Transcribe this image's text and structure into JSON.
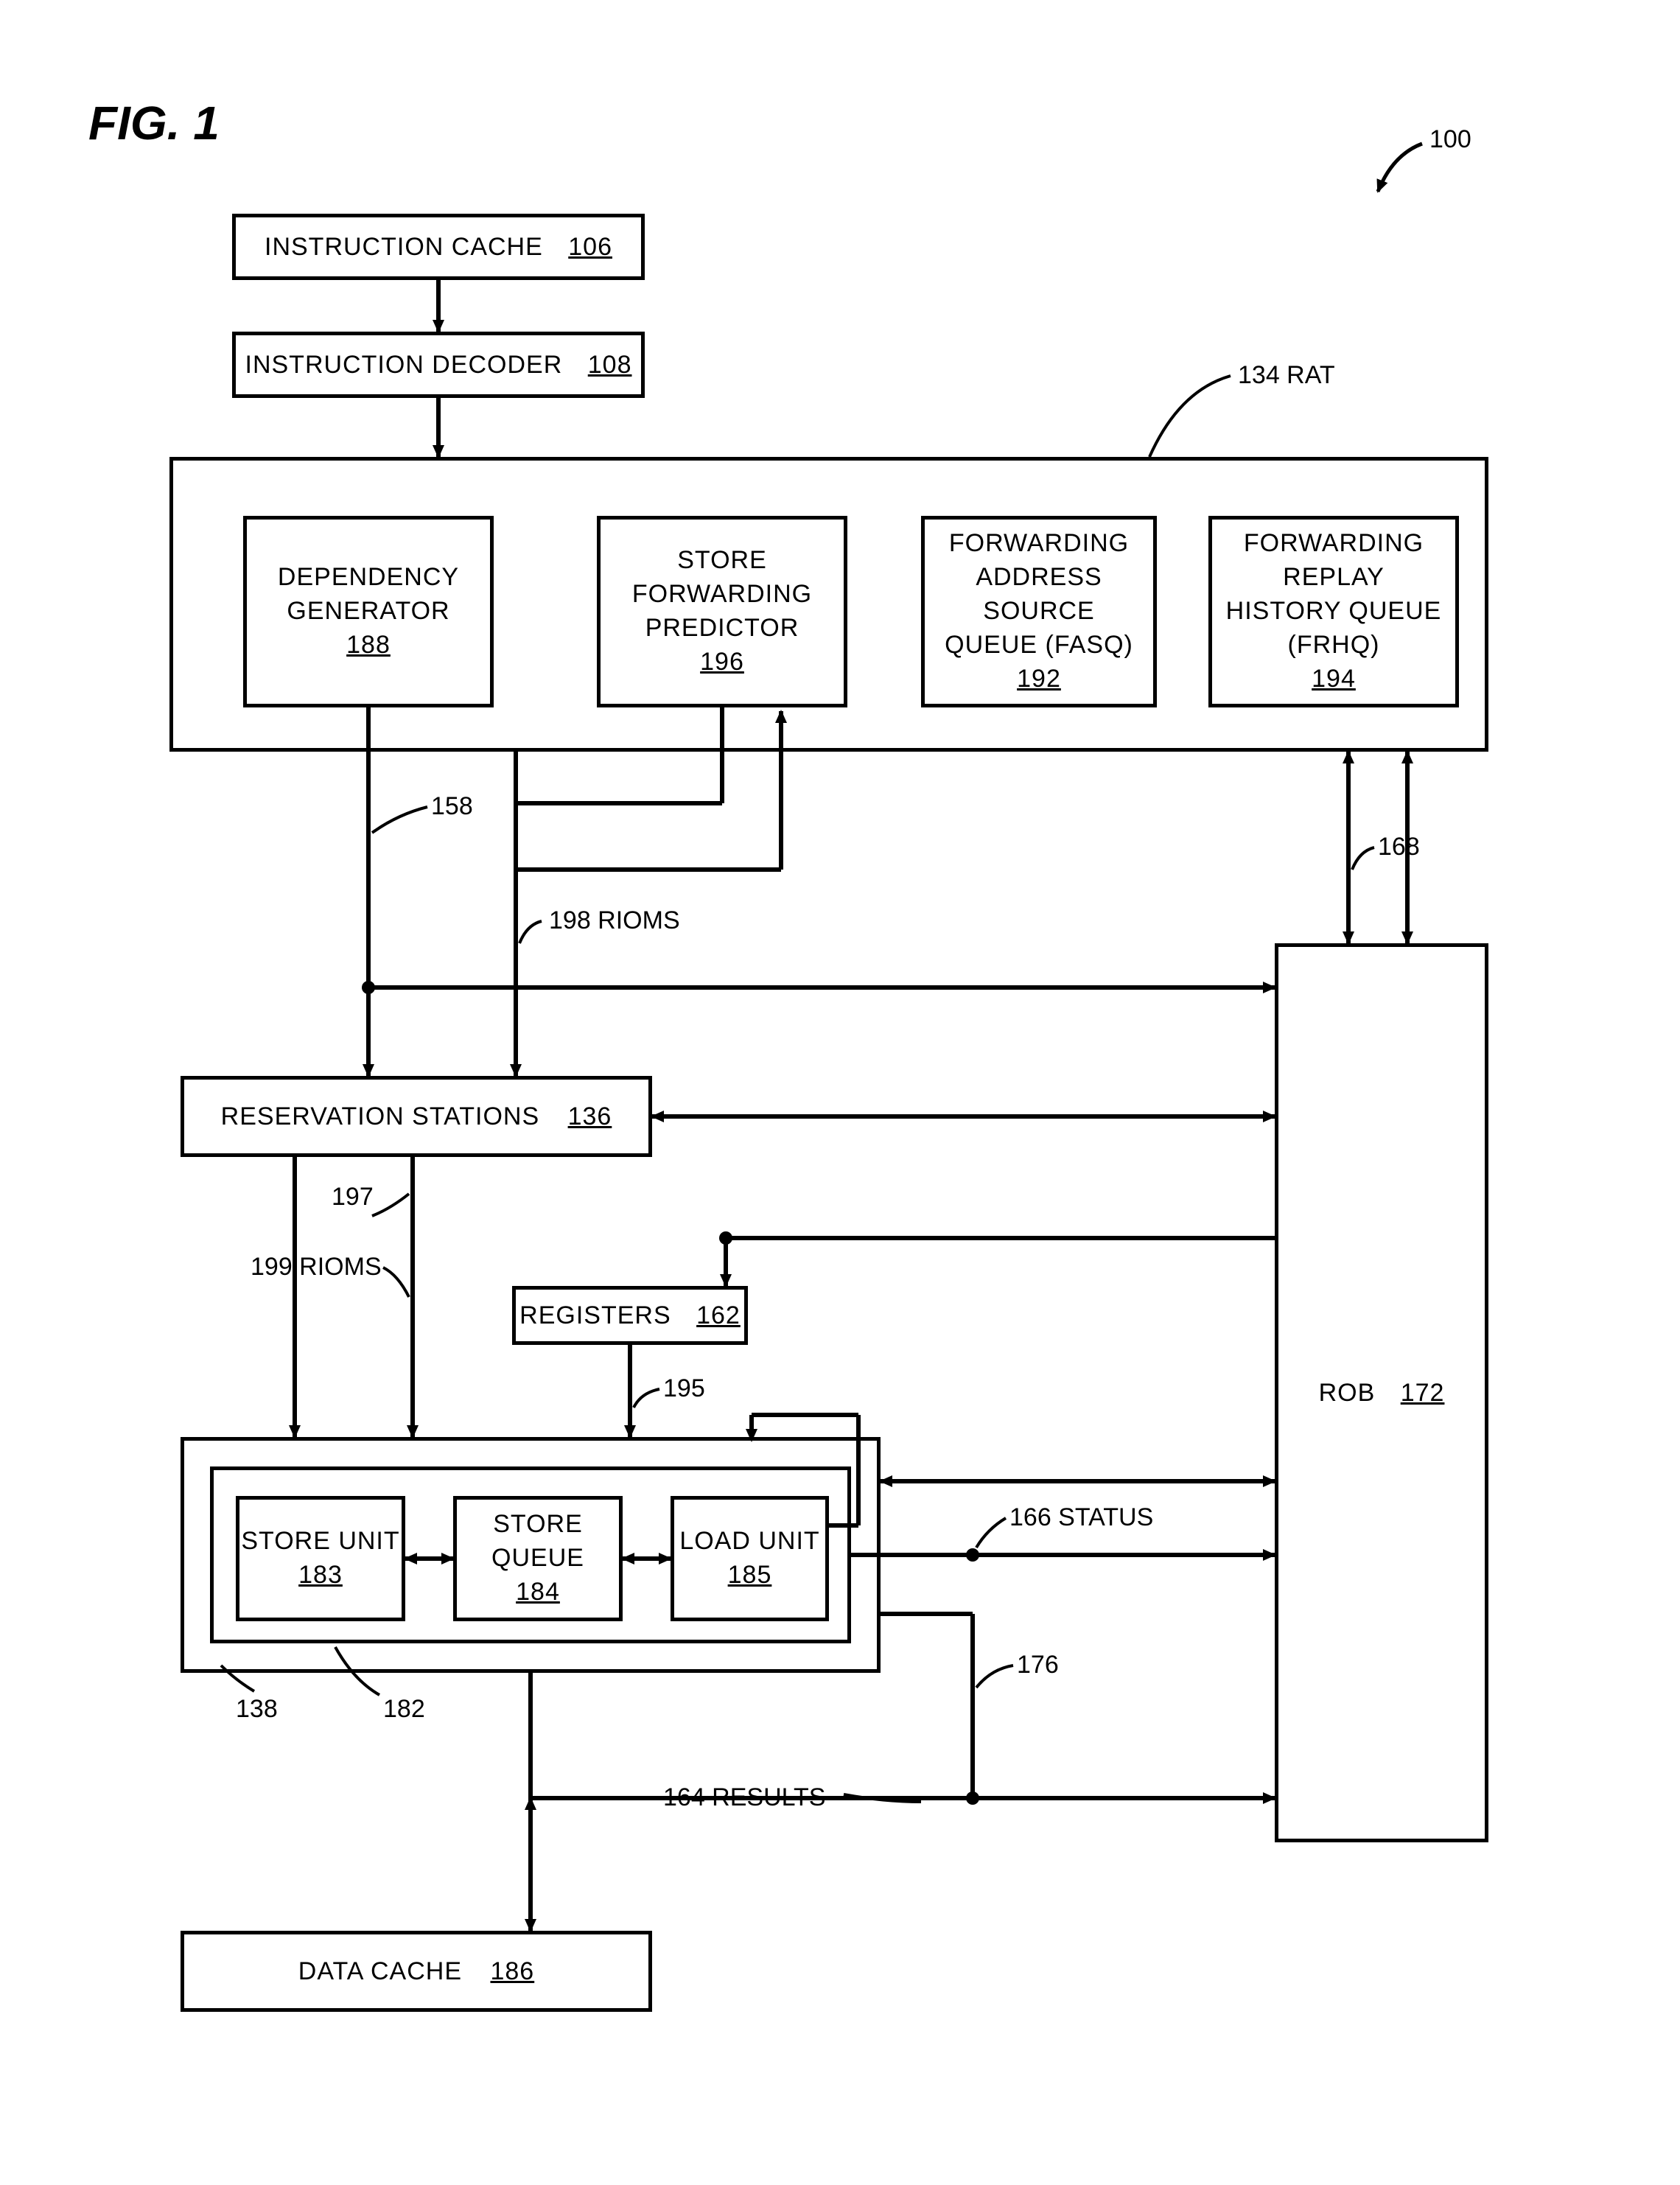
{
  "figure": {
    "title": "FIG. 1",
    "system_ref": "100"
  },
  "boxes": {
    "icache": {
      "label": "INSTRUCTION CACHE",
      "ref": "106"
    },
    "idecoder": {
      "label": "INSTRUCTION DECODER",
      "ref": "108"
    },
    "rat": {
      "ref": "134",
      "name": "RAT"
    },
    "depgen": {
      "label1": "DEPENDENCY",
      "label2": "GENERATOR",
      "ref": "188"
    },
    "sfpred": {
      "label1": "STORE",
      "label2": "FORWARDING",
      "label3": "PREDICTOR",
      "ref": "196"
    },
    "fasq": {
      "label1": "FORWARDING",
      "label2": "ADDRESS",
      "label3": "SOURCE",
      "label4": "QUEUE (FASQ)",
      "ref": "192"
    },
    "frhq": {
      "label1": "FORWARDING",
      "label2": "REPLAY",
      "label3": "HISTORY QUEUE",
      "label4": "(FRHQ)",
      "ref": "194"
    },
    "resv": {
      "label": "RESERVATION STATIONS",
      "ref": "136"
    },
    "regs": {
      "label": "REGISTERS",
      "ref": "162"
    },
    "memunit": {
      "ref": "182"
    },
    "storeunit": {
      "label": "STORE UNIT",
      "ref": "183"
    },
    "storequeue": {
      "label1": "STORE",
      "label2": "QUEUE",
      "ref": "184"
    },
    "loadunit": {
      "label": "LOAD UNIT",
      "ref": "185"
    },
    "rob": {
      "label": "ROB",
      "ref": "172"
    },
    "dcache": {
      "label": "DATA CACHE",
      "ref": "186"
    }
  },
  "labels": {
    "l158": "158",
    "l168": "168",
    "l198": "198 RIOMS",
    "l197": "197",
    "l199": "199 RIOMS",
    "l195": "195",
    "l166": "166 STATUS",
    "l176": "176",
    "l164": "164 RESULTS",
    "l138": "138",
    "l182": "182",
    "l134": "134  RAT"
  }
}
